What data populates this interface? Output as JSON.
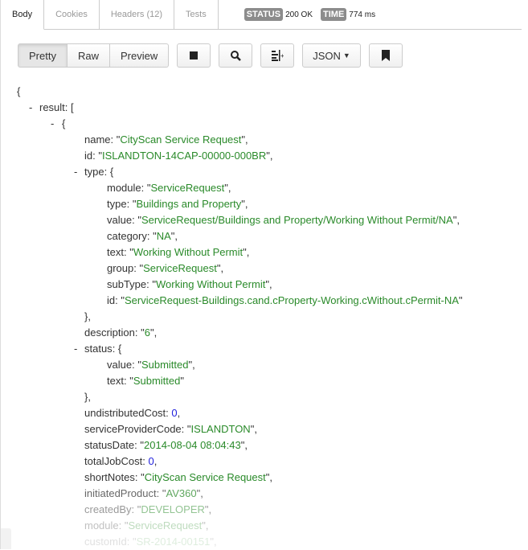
{
  "tabs": [
    {
      "label": "Body",
      "active": true
    },
    {
      "label": "Cookies"
    },
    {
      "label": "Headers (12)"
    },
    {
      "label": "Tests"
    }
  ],
  "status": {
    "status_label": "STATUS",
    "status_value": "200 OK",
    "time_label": "TIME",
    "time_value": "774 ms"
  },
  "toolbar": {
    "pretty": "Pretty",
    "raw": "Raw",
    "preview": "Preview",
    "format": "JSON"
  },
  "lines": [
    {
      "i": 0,
      "t": "{"
    },
    {
      "i": 1,
      "d": true,
      "k": "result",
      "t": " ["
    },
    {
      "i": 2,
      "d": true,
      "t": "{"
    },
    {
      "i": 3,
      "k": "name",
      "s": "CityScan Service Request",
      "t": ","
    },
    {
      "i": 3,
      "k": "id",
      "s": "ISLANDTON-14CAP-00000-000BR",
      "t": ","
    },
    {
      "i": 3,
      "d": true,
      "k": "type",
      "t": " {"
    },
    {
      "i": 4,
      "k": "module",
      "s": "ServiceRequest",
      "t": ","
    },
    {
      "i": 4,
      "k": "type",
      "s": "Buildings and Property",
      "t": ","
    },
    {
      "i": 4,
      "k": "value",
      "s": "ServiceRequest/Buildings and Property/Working Without Permit/NA",
      "t": ","
    },
    {
      "i": 4,
      "k": "category",
      "s": "NA",
      "t": ","
    },
    {
      "i": 4,
      "k": "text",
      "s": "Working Without Permit",
      "t": ","
    },
    {
      "i": 4,
      "k": "group",
      "s": "ServiceRequest",
      "t": ","
    },
    {
      "i": 4,
      "k": "subType",
      "s": "Working Without Permit",
      "t": ","
    },
    {
      "i": 4,
      "k": "id",
      "s": "ServiceRequest-Buildings.cand.cProperty-Working.cWithout.cPermit-NA"
    },
    {
      "i": 3,
      "t": "},"
    },
    {
      "i": 3,
      "k": "description",
      "s": "6",
      "t": ","
    },
    {
      "i": 3,
      "d": true,
      "k": "status",
      "t": " {"
    },
    {
      "i": 4,
      "k": "value",
      "s": "Submitted",
      "t": ","
    },
    {
      "i": 4,
      "k": "text",
      "s": "Submitted"
    },
    {
      "i": 3,
      "t": "},"
    },
    {
      "i": 3,
      "k": "undistributedCost",
      "n": "0",
      "t": ","
    },
    {
      "i": 3,
      "k": "serviceProviderCode",
      "s": "ISLANDTON",
      "t": ","
    },
    {
      "i": 3,
      "k": "statusDate",
      "s": "2014-08-04 08:04:43",
      "t": ","
    },
    {
      "i": 3,
      "k": "totalJobCost",
      "n": "0",
      "t": ","
    },
    {
      "i": 3,
      "k": "shortNotes",
      "s": "CityScan Service Request",
      "t": ","
    },
    {
      "i": 3,
      "k": "initiatedProduct",
      "s": "AV360",
      "t": ","
    },
    {
      "i": 3,
      "k": "createdBy",
      "s": "DEVELOPER",
      "t": ","
    },
    {
      "i": 3,
      "k": "module",
      "s": "ServiceRequest",
      "t": ","
    },
    {
      "i": 3,
      "k": "customId",
      "s": "SR-2014-00151",
      "t": ","
    }
  ]
}
